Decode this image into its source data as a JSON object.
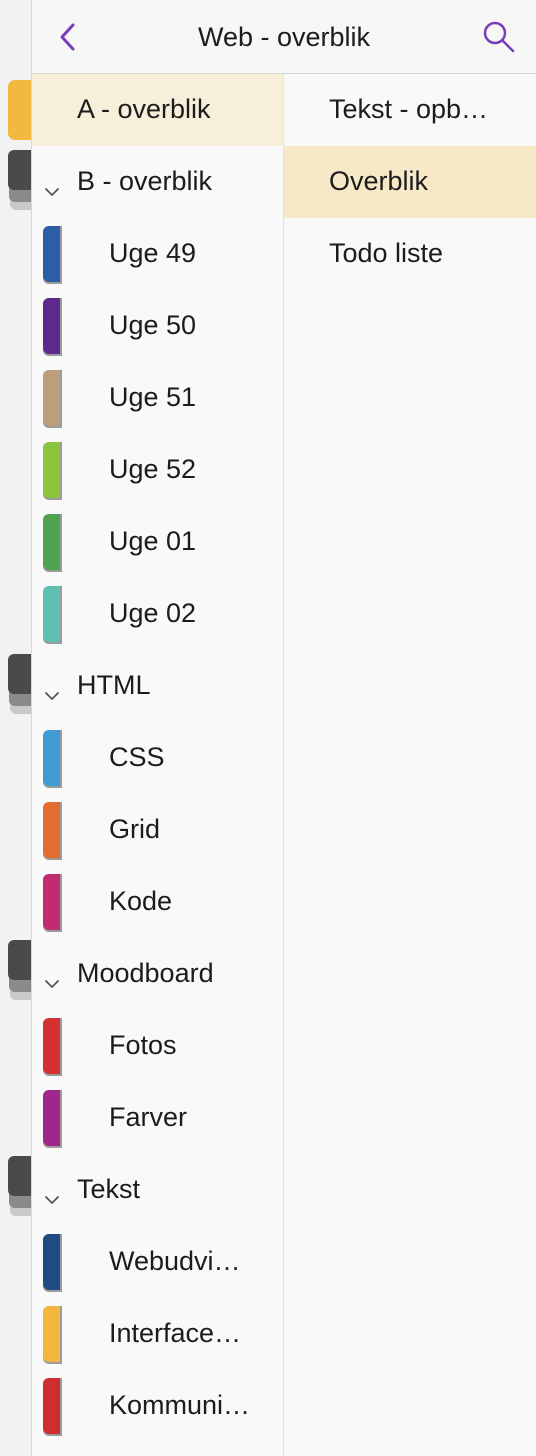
{
  "header": {
    "title": "Web - overblik",
    "back_icon": "chevron-left-icon",
    "search_icon": "search-icon",
    "accent": "#7a3db8"
  },
  "sections": {
    "top": {
      "label": "A - overblik",
      "selected": true,
      "color": "#f1b93f"
    },
    "groups": [
      {
        "label": "B - overblik",
        "items": [
          {
            "label": "Uge 49",
            "color": "#2c5ea8"
          },
          {
            "label": "Uge 50",
            "color": "#5b2a8c"
          },
          {
            "label": "Uge 51",
            "color": "#bb9e7c"
          },
          {
            "label": "Uge 52",
            "color": "#8cc43c"
          },
          {
            "label": "Uge 01",
            "color": "#4fa34f"
          },
          {
            "label": "Uge 02",
            "color": "#5fbfb3"
          }
        ]
      },
      {
        "label": "HTML",
        "items": [
          {
            "label": "CSS",
            "color": "#3f9bd4"
          },
          {
            "label": "Grid",
            "color": "#e26d2f"
          },
          {
            "label": "Kode",
            "color": "#c22b6f"
          }
        ]
      },
      {
        "label": "Moodboard",
        "items": [
          {
            "label": "Fotos",
            "color": "#d53131"
          },
          {
            "label": "Farver",
            "color": "#a0278a"
          }
        ]
      },
      {
        "label": "Tekst",
        "items": [
          {
            "label": "Webudvi…",
            "color": "#1e4b82"
          },
          {
            "label": "Interface…",
            "color": "#f2b83e"
          },
          {
            "label": "Kommuni…",
            "color": "#cf2e2e"
          }
        ]
      }
    ]
  },
  "pages": [
    {
      "label": "Tekst - opb…",
      "selected": false
    },
    {
      "label": "Overblik",
      "selected": true
    },
    {
      "label": "Todo liste",
      "selected": false
    }
  ],
  "notebooks": [
    {
      "color": "#f1b93f",
      "type": "single"
    },
    {
      "color": "#4a4a4a",
      "type": "stack"
    },
    {
      "color": "#4a4a4a",
      "type": "stack"
    },
    {
      "color": "#4a4a4a",
      "type": "stack"
    },
    {
      "color": "#4a4a4a",
      "type": "stack"
    }
  ]
}
